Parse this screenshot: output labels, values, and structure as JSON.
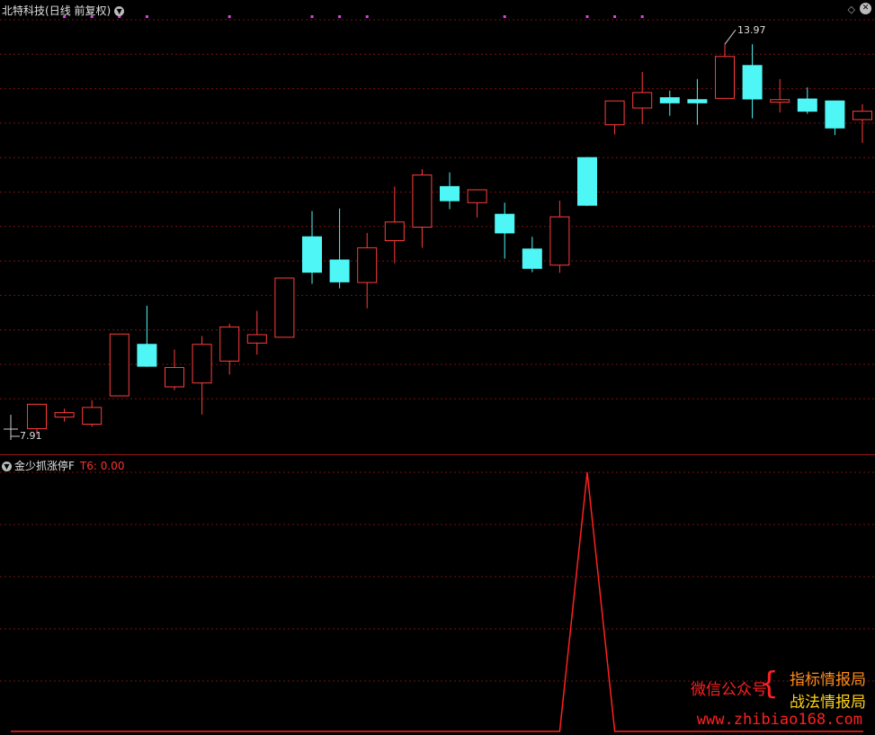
{
  "header": {
    "stock_name": "北特科技",
    "period": "(日线 前复权)"
  },
  "indicator": {
    "name": "金少抓涨停F",
    "value_label": "T6: 0.00"
  },
  "annotations": {
    "max_label": "13.97",
    "min_label": "7.91"
  },
  "icons": {
    "header_dropdown": "chevron-down-icon",
    "diamond": "diamond-icon",
    "close": "close-icon",
    "indicator_dropdown": "chevron-down-icon"
  },
  "colors": {
    "up": "#ff3c3c",
    "down": "#4ff6f6",
    "grid": "#7a1010",
    "marker": "#e040e0",
    "indicator_line": "#ff2020"
  },
  "watermark": {
    "left": "微信公众号",
    "right_1": "指标情报局",
    "right_2": "战法情报局",
    "url": "www.zhibiao168.com"
  },
  "chart_data": [
    {
      "type": "candlestick",
      "ylim": [
        7.7,
        14.35
      ],
      "candles": [
        {
          "o": 8.0,
          "h": 8.37,
          "l": 7.91,
          "c": 8.38
        },
        {
          "o": 8.18,
          "h": 8.31,
          "l": 8.11,
          "c": 8.25
        },
        {
          "o": 8.07,
          "h": 8.44,
          "l": 8.03,
          "c": 8.33
        },
        {
          "o": 8.51,
          "h": 9.47,
          "l": 8.51,
          "c": 9.47
        },
        {
          "o": 9.31,
          "h": 9.91,
          "l": 8.96,
          "c": 8.97
        },
        {
          "o": 8.65,
          "h": 9.23,
          "l": 8.6,
          "c": 8.95
        },
        {
          "o": 8.71,
          "h": 9.44,
          "l": 8.22,
          "c": 9.31
        },
        {
          "o": 9.05,
          "h": 9.63,
          "l": 8.84,
          "c": 9.58
        },
        {
          "o": 9.33,
          "h": 9.83,
          "l": 9.15,
          "c": 9.46
        },
        {
          "o": 9.42,
          "h": 10.34,
          "l": 9.42,
          "c": 10.34
        },
        {
          "o": 10.98,
          "h": 11.38,
          "l": 10.25,
          "c": 10.43
        },
        {
          "o": 10.62,
          "h": 11.42,
          "l": 10.18,
          "c": 10.28
        },
        {
          "o": 10.27,
          "h": 11.04,
          "l": 9.87,
          "c": 10.81
        },
        {
          "o": 10.92,
          "h": 11.76,
          "l": 10.57,
          "c": 11.21
        },
        {
          "o": 11.13,
          "h": 12.03,
          "l": 10.81,
          "c": 11.94
        },
        {
          "o": 11.76,
          "h": 11.98,
          "l": 11.41,
          "c": 11.54
        },
        {
          "o": 11.51,
          "h": 11.67,
          "l": 11.28,
          "c": 11.71
        },
        {
          "o": 11.33,
          "h": 11.51,
          "l": 10.64,
          "c": 11.04
        },
        {
          "o": 10.79,
          "h": 10.98,
          "l": 10.43,
          "c": 10.49
        },
        {
          "o": 10.54,
          "h": 11.54,
          "l": 10.42,
          "c": 11.29
        },
        {
          "o": 12.21,
          "h": 12.22,
          "l": 11.46,
          "c": 11.47
        },
        {
          "o": 12.72,
          "h": 13.09,
          "l": 12.57,
          "c": 13.09
        },
        {
          "o": 12.98,
          "h": 13.54,
          "l": 12.73,
          "c": 13.22
        },
        {
          "o": 13.14,
          "h": 13.25,
          "l": 12.86,
          "c": 13.06
        },
        {
          "o": 13.11,
          "h": 13.43,
          "l": 12.72,
          "c": 13.06
        },
        {
          "o": 13.13,
          "h": 13.97,
          "l": 13.13,
          "c": 13.78
        },
        {
          "o": 13.64,
          "h": 13.97,
          "l": 12.82,
          "c": 13.12
        },
        {
          "o": 13.07,
          "h": 13.43,
          "l": 12.91,
          "c": 13.11
        },
        {
          "o": 13.12,
          "h": 13.3,
          "l": 12.89,
          "c": 12.93
        },
        {
          "o": 13.09,
          "h": 13.09,
          "l": 12.56,
          "c": 12.67
        },
        {
          "o": 12.8,
          "h": 13.04,
          "l": 12.44,
          "c": 12.93
        }
      ],
      "signal_markers": [
        1,
        2,
        3,
        4,
        7,
        10,
        11,
        12,
        17,
        20,
        21,
        22
      ]
    },
    {
      "type": "line",
      "series": [
        {
          "values": [
            0,
            0,
            0,
            0,
            0,
            0,
            0,
            0,
            0,
            0,
            0,
            0,
            0,
            0,
            0,
            0,
            0,
            0,
            0,
            0,
            1,
            0,
            0,
            0,
            0,
            0,
            0,
            0,
            0,
            0,
            0
          ]
        }
      ],
      "ylim": [
        0,
        1
      ]
    }
  ]
}
